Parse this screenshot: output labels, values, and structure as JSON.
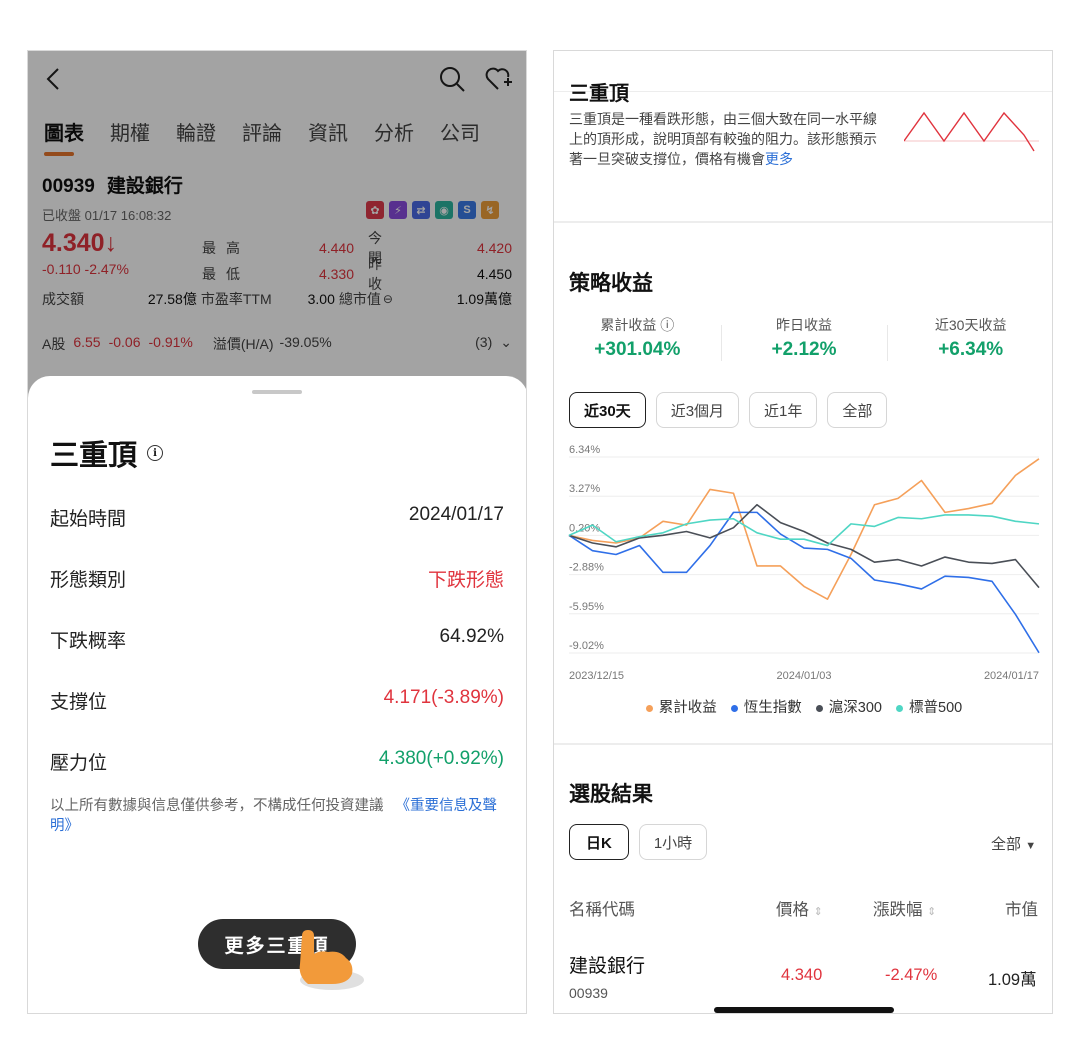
{
  "left": {
    "tabs": [
      "圖表",
      "期權",
      "輪證",
      "評論",
      "資訊",
      "分析",
      "公司"
    ],
    "stock": {
      "code": "00939",
      "name": "建設銀行",
      "status": "已收盤 01/17 16:08:32",
      "price": "4.340",
      "change": "-0.110 -2.47%",
      "quote": {
        "high_label": "最高",
        "high": "4.440",
        "open_label": "今開",
        "open": "4.420",
        "low_label": "最低",
        "low": "4.330",
        "prev_label": "昨收",
        "prev": "4.450"
      },
      "volume_label": "成交額",
      "volume": "27.58億",
      "pe_label": "市盈率TTM",
      "pe": "3.00",
      "mcap_label": "總市值",
      "mcap": "1.09萬億",
      "a_share_label": "A股",
      "a_price": "6.55",
      "a_change": "-0.06",
      "a_pct": "-0.91%",
      "premium_label": "溢價(H/A)",
      "premium": "-39.05%",
      "count": "(3)"
    },
    "sheet": {
      "title": "三重頂",
      "rows": [
        {
          "label": "起始時間",
          "value": "2024/01/17"
        },
        {
          "label": "形態類別",
          "value": "下跌形態"
        },
        {
          "label": "下跌概率",
          "value": "64.92%"
        },
        {
          "label": "支撐位",
          "value": "4.171(-3.89%)"
        },
        {
          "label": "壓力位",
          "value": "4.380(+0.92%)"
        }
      ],
      "disclaimer": "以上所有數據與信息僅供參考，不構成任何投資建議",
      "disclaimer_link": "《重要信息及聲明》",
      "more_button": "更多三重頂"
    }
  },
  "right": {
    "pattern": {
      "title": "三重頂",
      "desc": "三重頂是一種看跌形態，由三個大致在同一水平線上的頂形成，說明頂部有較強的阻力。該形態預示著一旦突破支撐位，價格有機會",
      "more": "更多"
    },
    "strategy": {
      "title": "策略收益",
      "metrics": [
        {
          "label": "累計收益",
          "value": "+301.04%"
        },
        {
          "label": "昨日收益",
          "value": "+2.12%"
        },
        {
          "label": "近30天收益",
          "value": "+6.34%"
        }
      ],
      "periods": [
        "近30天",
        "近3個月",
        "近1年",
        "全部"
      ]
    },
    "stock_selection": {
      "title": "選股結果",
      "timeframes": [
        "日K",
        "1小時"
      ],
      "filter": "全部",
      "headers": [
        "名稱代碼",
        "價格",
        "漲跌幅",
        "市值"
      ],
      "rows": [
        {
          "name": "建設銀行",
          "code": "00939",
          "price": "4.340",
          "change": "-2.47%",
          "mcap": "1.09萬"
        }
      ]
    }
  },
  "colors": {
    "red": "#e0343e",
    "green": "#12a06a",
    "link": "#2b6fd6",
    "orange": "#f5a05a",
    "blue": "#2f6fe8",
    "darkgrey": "#4a4f57",
    "teal": "#4fd6c4"
  },
  "chart_data": {
    "type": "line",
    "title": "",
    "x": [
      "2023/12/15",
      "2023/12/18",
      "2023/12/19",
      "2023/12/20",
      "2023/12/21",
      "2023/12/22",
      "2023/12/27",
      "2023/12/28",
      "2023/12/29",
      "2024/01/02",
      "2024/01/03",
      "2024/01/04",
      "2024/01/05",
      "2024/01/08",
      "2024/01/09",
      "2024/01/10",
      "2024/01/11",
      "2024/01/12",
      "2024/01/15",
      "2024/01/16",
      "2024/01/17"
    ],
    "x_tick_labels": [
      "2023/12/15",
      "2024/01/03",
      "2024/01/17"
    ],
    "y_tick_labels": [
      "6.34%",
      "3.27%",
      "0.20%",
      "-2.88%",
      "-5.95%",
      "-9.02%"
    ],
    "ylim": [
      -9.02,
      6.34
    ],
    "series": [
      {
        "name": "累計收益",
        "color": "#f5a05a",
        "values": [
          0.2,
          -0.2,
          -0.4,
          0.0,
          1.3,
          1.0,
          3.8,
          3.5,
          -2.2,
          -2.2,
          -3.8,
          -4.8,
          -1.3,
          2.6,
          3.1,
          4.5,
          2.0,
          2.3,
          2.7,
          4.9,
          6.2
        ]
      },
      {
        "name": "恆生指數",
        "color": "#2f6fe8",
        "values": [
          0.2,
          -1.0,
          -1.3,
          -0.6,
          -2.7,
          -2.7,
          -0.6,
          2.0,
          2.0,
          0.3,
          -0.8,
          -0.9,
          -1.6,
          -3.3,
          -3.6,
          -4.0,
          -3.0,
          -3.1,
          -3.4,
          -6.0,
          -9.0
        ]
      },
      {
        "name": "滬深300",
        "color": "#4a4f57",
        "values": [
          0.2,
          -0.4,
          -0.7,
          0.0,
          0.2,
          0.5,
          0.0,
          0.8,
          2.6,
          1.2,
          0.5,
          -0.4,
          -0.9,
          -1.9,
          -1.7,
          -2.2,
          -1.5,
          -1.9,
          -2.0,
          -1.7,
          -3.9
        ]
      },
      {
        "name": "標普500",
        "color": "#4fd6c4",
        "values": [
          0.2,
          1.0,
          -0.3,
          0.1,
          0.4,
          1.1,
          1.4,
          1.5,
          0.4,
          -0.1,
          -0.1,
          -0.6,
          1.1,
          0.9,
          1.6,
          1.5,
          1.8,
          1.8,
          1.7,
          1.3,
          1.1
        ]
      }
    ]
  }
}
